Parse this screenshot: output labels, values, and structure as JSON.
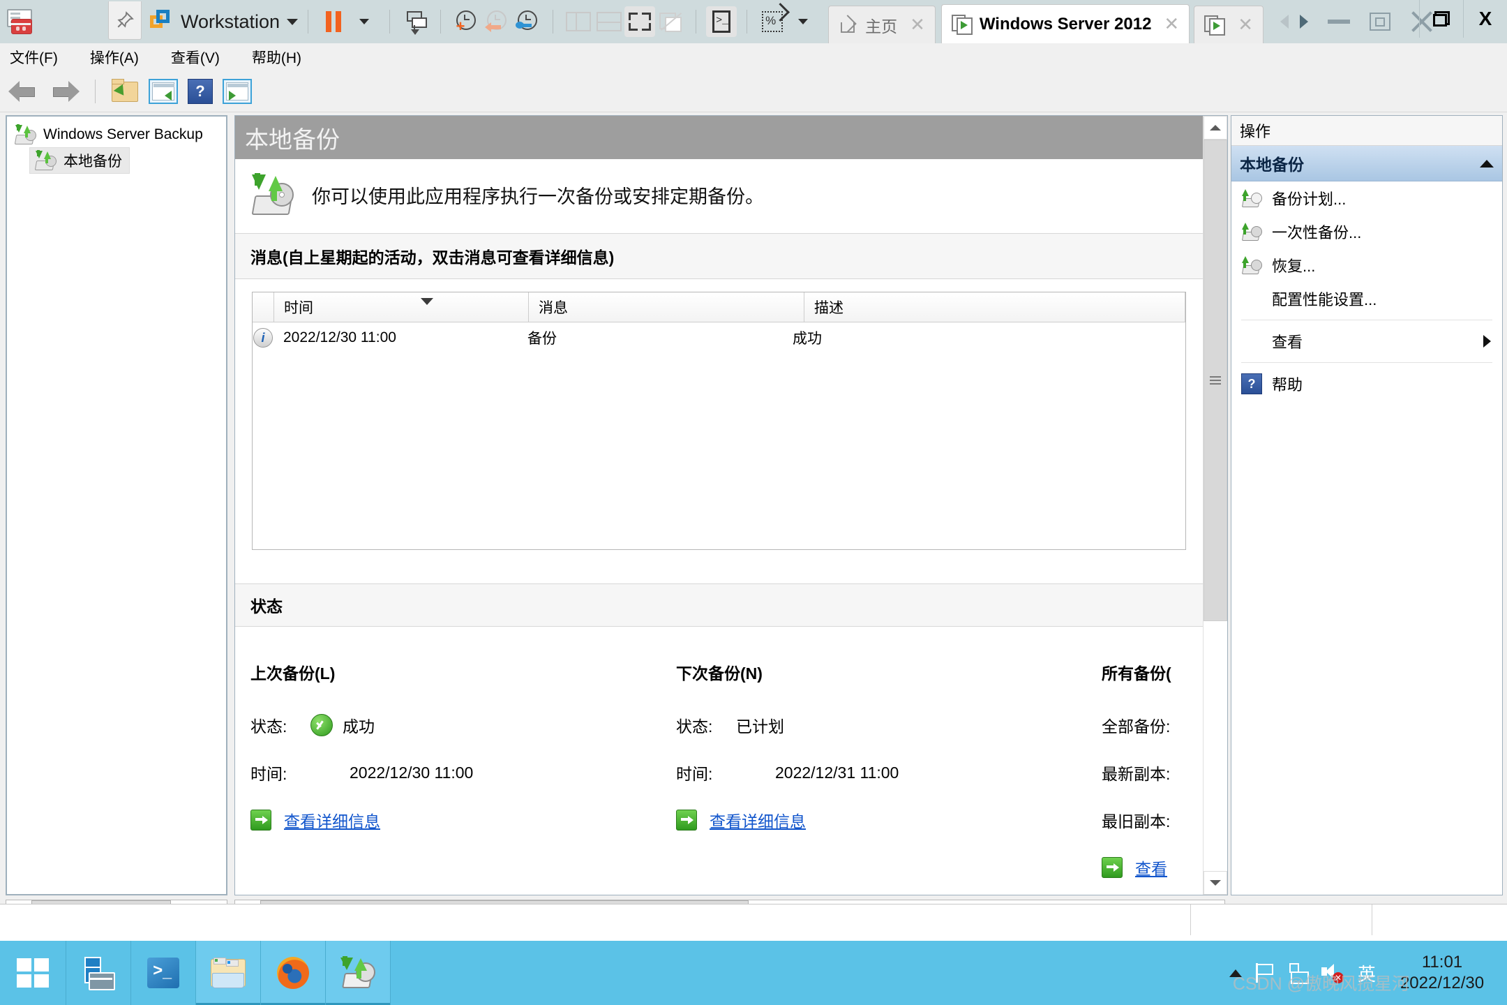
{
  "vmware": {
    "app_icon": "vmware-workstation-icon",
    "pin_icon": "pin-icon",
    "product_label": "Workstation",
    "product_dropdown_icon": "chevron-down-icon",
    "toolbar_icons": [
      "pause-vm-icon",
      "pause-dropdown-icon",
      "snapshot-icon",
      "take-snapshot-icon",
      "revert-snapshot-icon",
      "snapshot-manager-icon",
      "layout-sidebar-icon",
      "layout-bottom-icon",
      "fullscreen-icon",
      "unity-mode-icon",
      "console-icon",
      "stretch-guest-icon",
      "stretch-dropdown-icon"
    ],
    "tabs": [
      {
        "label": "主页",
        "icon": "home-icon",
        "active": false,
        "close_icon": "close-icon"
      },
      {
        "label": "Windows Server 2012",
        "icon": "vm-running-icon",
        "active": true,
        "close_icon": "close-icon"
      },
      {
        "label": "",
        "icon": "vm-running-icon",
        "active": false,
        "close_icon": "close-icon"
      }
    ],
    "nav_back_icon": "nav-back-icon",
    "nav_forward_icon": "nav-forward-icon",
    "window_minimize_icon": "minimize-icon",
    "window_restore_icon": "restore-icon",
    "window_close_icon": "close-icon",
    "sys_restore_icon": "restore-icon",
    "sys_close_label": "X"
  },
  "mmc": {
    "menu": [
      {
        "label": "文件(F)"
      },
      {
        "label": "操作(A)"
      },
      {
        "label": "查看(V)"
      },
      {
        "label": "帮助(H)"
      }
    ],
    "toolbar_icons": [
      "back-arrow-icon",
      "forward-arrow-icon",
      "show-folder-icon",
      "show-console-tree-icon",
      "help-icon",
      "show-action-pane-icon"
    ],
    "tree": {
      "root": {
        "label": "Windows Server Backup",
        "icon": "backup-icon"
      },
      "child": {
        "label": "本地备份",
        "icon": "backup-icon",
        "selected": true
      }
    },
    "main": {
      "header_title": "本地备份",
      "intro_icon": "backup-large-icon",
      "intro_text": "你可以使用此应用程序执行一次备份或安排定期备份。",
      "messages_section_title": "消息(自上星期起的活动，双击消息可查看详细信息)",
      "messages_table": {
        "columns": [
          "",
          "时间",
          "消息",
          "描述"
        ],
        "sorted_column": "时间",
        "sort_direction": "desc",
        "rows": [
          {
            "icon": "information-icon",
            "time": "2022/12/30 11:00",
            "message": "备份",
            "description": "成功"
          }
        ]
      },
      "status_section_title": "状态",
      "status_columns": [
        {
          "title": "上次备份(L)",
          "status_label": "状态:",
          "status_value": "成功",
          "status_icon": "success-icon",
          "time_label": "时间:",
          "time_value": "2022/12/30 11:00",
          "link_label": "查看详细信息",
          "link_icon": "go-arrow-icon"
        },
        {
          "title": "下次备份(N)",
          "status_label": "状态:",
          "status_value": "已计划",
          "status_icon": "",
          "time_label": "时间:",
          "time_value": "2022/12/31 11:00",
          "link_label": "查看详细信息",
          "link_icon": "go-arrow-icon"
        },
        {
          "title": "所有备份(",
          "row1_label": "全部备份:",
          "row2_label": "最新副本:",
          "row3_label": "最旧副本:",
          "link_label": "查看",
          "link_icon": "go-arrow-icon"
        }
      ]
    },
    "actions": {
      "pane_title": "操作",
      "group_title": "本地备份",
      "group_collapse_icon": "chevron-up-icon",
      "items": [
        {
          "label": "备份计划...",
          "icon": "backup-schedule-icon",
          "has_icon": true,
          "submenu": false
        },
        {
          "label": "一次性备份...",
          "icon": "backup-once-icon",
          "has_icon": true,
          "submenu": false
        },
        {
          "label": "恢复...",
          "icon": "recover-icon",
          "has_icon": true,
          "submenu": false
        },
        {
          "label": "配置性能设置...",
          "icon": "",
          "has_icon": false,
          "submenu": false
        },
        {
          "label": "查看",
          "icon": "",
          "has_icon": false,
          "submenu": true,
          "submenu_icon": "chevron-right-icon"
        },
        {
          "label": "帮助",
          "icon": "help-icon",
          "has_icon": true,
          "submenu": false
        }
      ]
    },
    "scrollbars": {
      "tree_h_left_icon": "chevron-left-icon",
      "tree_h_right_icon": "chevron-right-icon",
      "tree_h_grip": "grip-icon",
      "main_h_left_icon": "chevron-left-icon",
      "main_h_right_icon": "chevron-right-icon",
      "main_h_grip": "grip-icon",
      "main_v_up_icon": "chevron-up-icon",
      "main_v_down_icon": "chevron-down-icon",
      "main_v_grip": "grip-icon"
    }
  },
  "taskbar": {
    "start_icon": "windows-start-icon",
    "pinned": [
      {
        "icon": "server-manager-icon",
        "name": "server-manager"
      },
      {
        "icon": "powershell-icon",
        "name": "powershell"
      },
      {
        "icon": "file-explorer-icon",
        "name": "file-explorer"
      },
      {
        "icon": "firefox-icon",
        "name": "firefox"
      },
      {
        "icon": "windows-server-backup-icon",
        "name": "windows-server-backup"
      }
    ],
    "tray": {
      "overflow_icon": "show-hidden-icons-icon",
      "flag_icon": "action-center-icon",
      "network_icon": "network-icon",
      "volume_icon": "volume-muted-icon",
      "ime_label": "英",
      "time": "11:01",
      "date": "2022/12/30"
    },
    "watermark": "CSDN @傲晚风揽星河"
  },
  "colors": {
    "vmware_titlebar": "#cfdbdd",
    "taskbar": "#5bc2e7",
    "accent_orange": "#f2621f",
    "action_group": "#a9c6e3",
    "link": "#1155cc",
    "header_gray": "#9e9e9e"
  }
}
